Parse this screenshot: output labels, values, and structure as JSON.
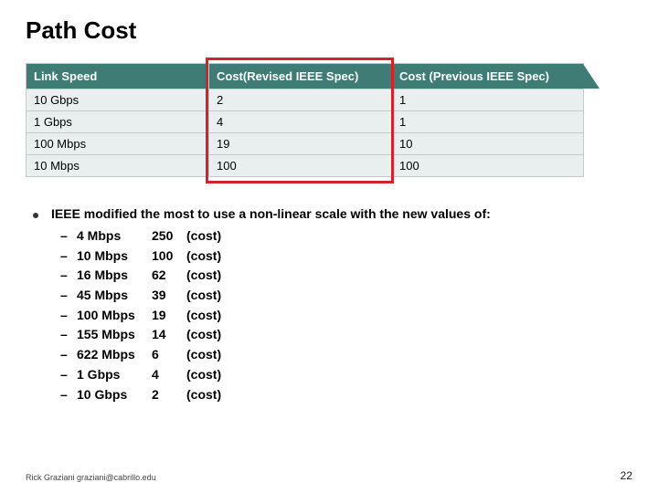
{
  "title": "Path Cost",
  "table": {
    "headers": [
      "Link Speed",
      "Cost(Revised IEEE Spec)",
      "Cost (Previous IEEE Spec)"
    ],
    "rows": [
      {
        "speed": "10 Gbps",
        "revised": "2",
        "previous": "1"
      },
      {
        "speed": "1 Gbps",
        "revised": "4",
        "previous": "1"
      },
      {
        "speed": "100 Mbps",
        "revised": "19",
        "previous": "10"
      },
      {
        "speed": "10 Mbps",
        "revised": "100",
        "previous": "100"
      }
    ]
  },
  "lead_text_prefix": "IEEE modified the most to use a ",
  "lead_text_bold": "non-linear scale",
  "lead_text_suffix": " with the new values of:",
  "cost_list": [
    {
      "speed": "4 Mbps",
      "value": "250",
      "label": "(cost)"
    },
    {
      "speed": "10 Mbps",
      "value": "100",
      "label": "(cost)"
    },
    {
      "speed": "16 Mbps",
      "value": "62",
      "label": "(cost)"
    },
    {
      "speed": "45 Mbps",
      "value": "39",
      "label": "(cost)"
    },
    {
      "speed": "100 Mbps",
      "value": "19",
      "label": "(cost)"
    },
    {
      "speed": "155 Mbps",
      "value": "14",
      "label": "(cost)"
    },
    {
      "speed": "622 Mbps",
      "value": "6",
      "label": "(cost)"
    },
    {
      "speed": "1 Gbps",
      "value": "4",
      "label": "(cost)"
    },
    {
      "speed": "10 Gbps",
      "value": "2",
      "label": "(cost)"
    }
  ],
  "footer_left": "Rick Graziani  graziani@cabrillo.edu",
  "footer_right": "22",
  "dash": "–"
}
